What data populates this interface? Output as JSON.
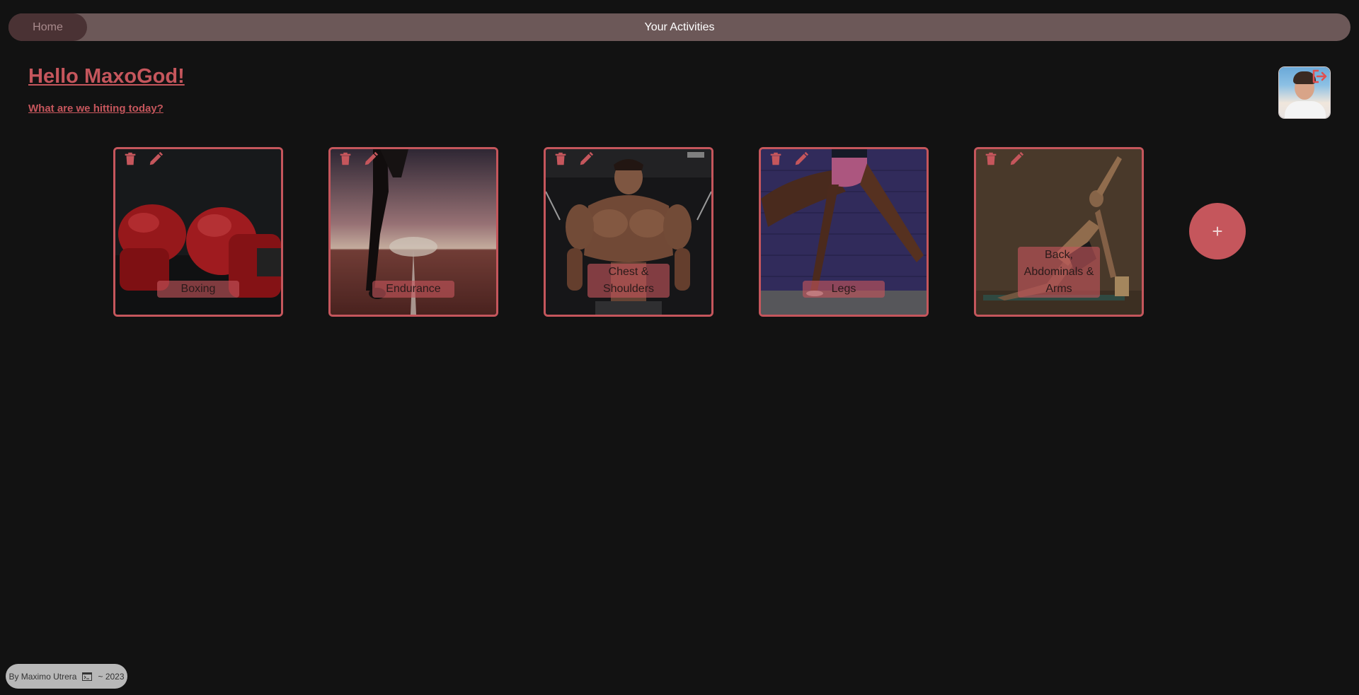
{
  "nav": {
    "home_label": "Home",
    "title": "Your Activities"
  },
  "header": {
    "greeting": "Hello MaxoGod!",
    "subtitle": "What are we hitting today?"
  },
  "colors": {
    "accent": "#c5565c",
    "background": "#121212",
    "topbar": "#6c5858",
    "home_button": "#4a3234"
  },
  "activities": [
    {
      "label": "Boxing",
      "image": "boxing-gloves"
    },
    {
      "label": "Endurance",
      "image": "runner-on-track"
    },
    {
      "label": "Chest & Shoulders",
      "image": "bodybuilder-cables"
    },
    {
      "label": "Legs",
      "image": "legs-jumping"
    },
    {
      "label": "Back, Abdominals & Arms",
      "image": "side-plank-yoga"
    }
  ],
  "icons": {
    "delete": "trash-icon",
    "edit": "pencil-icon",
    "logout": "logout-icon",
    "terminal": "terminal-icon"
  },
  "add_button_label": "+",
  "footer": {
    "author": "By Maximo Utrera",
    "year": "~ 2023"
  }
}
